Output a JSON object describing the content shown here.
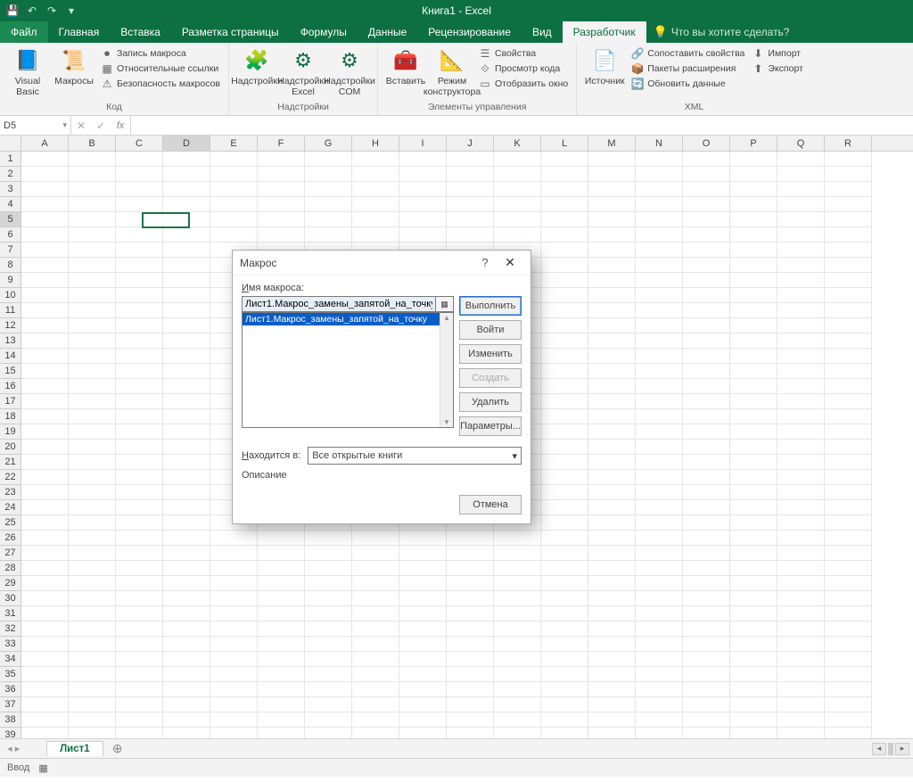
{
  "app_title": "Книга1 - Excel",
  "qat": {
    "save": "💾",
    "undo": "↶",
    "redo": "↷",
    "more": "▾"
  },
  "tabs": {
    "file": "Файл",
    "items": [
      "Главная",
      "Вставка",
      "Разметка страницы",
      "Формулы",
      "Данные",
      "Рецензирование",
      "Вид",
      "Разработчик"
    ],
    "active": "Разработчик",
    "tellme_icon": "💡",
    "tellme": "Что вы хотите сделать?"
  },
  "ribbon": {
    "groups": {
      "code": {
        "label": "Код",
        "visual_basic": "Visual\nBasic",
        "macros": "Макросы",
        "record": "Запись макроса",
        "relative": "Относительные ссылки",
        "security": "Безопасность макросов"
      },
      "addins": {
        "label": "Надстройки",
        "addins": "Надстройки",
        "excel_addins": "Надстройки\nExcel",
        "com_addins": "Надстройки\nCOM"
      },
      "controls": {
        "label": "Элементы управления",
        "insert": "Вставить",
        "design": "Режим\nконструктора",
        "properties": "Свойства",
        "view_code": "Просмотр кода",
        "show_window": "Отобразить окно"
      },
      "xml": {
        "label": "XML",
        "source": "Источник",
        "map_props": "Сопоставить свойства",
        "ext_packs": "Пакеты расширения",
        "refresh": "Обновить данные",
        "import": "Импорт",
        "export": "Экспорт"
      }
    }
  },
  "formula_bar": {
    "name_box": "D5",
    "fx": "fx",
    "value": ""
  },
  "grid": {
    "columns": [
      "A",
      "B",
      "C",
      "D",
      "E",
      "F",
      "G",
      "H",
      "I",
      "J",
      "K",
      "L",
      "M",
      "N",
      "O",
      "P",
      "Q",
      "R"
    ],
    "rows_count": 39,
    "selected": {
      "col": "D",
      "row": 5
    }
  },
  "sheet_bar": {
    "active": "Лист1",
    "add": "⊕"
  },
  "status": {
    "text": "Ввод",
    "macro_icon": "▦"
  },
  "dialog": {
    "title": "Макрос",
    "help": "?",
    "close": "✕",
    "name_label": "Имя макроса:",
    "name_value": "Лист1.Макрос_замены_запятой_на_точку",
    "list_item": "Лист1.Макрос_замены_запятой_на_точку",
    "buttons": {
      "run": "Выполнить",
      "step": "Войти",
      "edit": "Изменить",
      "create": "Создать",
      "delete": "Удалить",
      "options": "Параметры..."
    },
    "location_label": "Находится в:",
    "location_value": "Все открытые книги",
    "description_label": "Описание",
    "cancel": "Отмена"
  }
}
